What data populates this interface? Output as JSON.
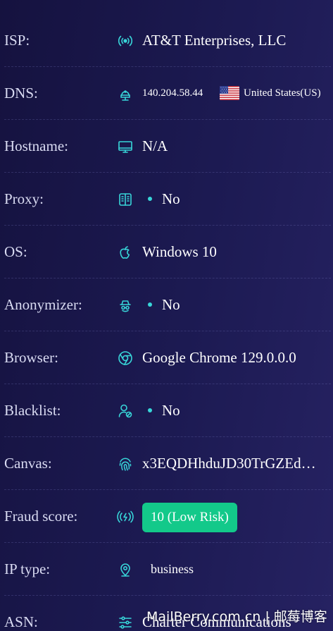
{
  "rows": [
    {
      "label": "ISP:",
      "icon": "antenna-icon",
      "value": "AT&T Enterprises, LLC"
    },
    {
      "label": "DNS:",
      "icon": "server-icon",
      "value": "140.204.58.44",
      "country": "United States(US)",
      "flag": "us-flag"
    },
    {
      "label": "Hostname:",
      "icon": "monitor-icon",
      "value": "N/A"
    },
    {
      "label": "Proxy:",
      "icon": "proxy-icon",
      "value": "No"
    },
    {
      "label": "OS:",
      "icon": "apple-icon",
      "value": "Windows 10"
    },
    {
      "label": "Anonymizer:",
      "icon": "spy-icon",
      "value": "No"
    },
    {
      "label": "Browser:",
      "icon": "chrome-icon",
      "value": "Google Chrome 129.0.0.0"
    },
    {
      "label": "Blacklist:",
      "icon": "user-block-icon",
      "value": "No"
    },
    {
      "label": "Canvas:",
      "icon": "fingerprint-icon",
      "value": "x3EQDHhduJD30TrGZEd…"
    },
    {
      "label": "Fraud score:",
      "icon": "signal-icon",
      "value": "10 (Low Risk)"
    },
    {
      "label": "IP type:",
      "icon": "location-pin-icon",
      "value": "business"
    },
    {
      "label": "ASN:",
      "icon": "sliders-icon",
      "value": "Charter Communications"
    }
  ],
  "colors": {
    "accent": "#38d6d9",
    "badge": "#13c98a",
    "background": "#1c1a52"
  },
  "watermark": "MailBerry.com.cn | 邮莓博客"
}
